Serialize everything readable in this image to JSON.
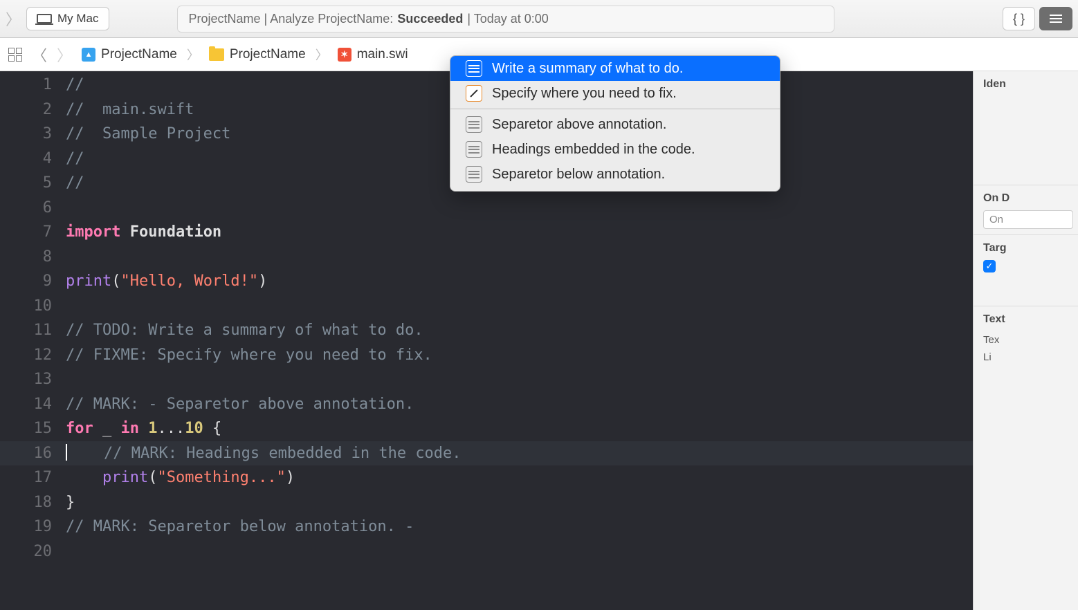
{
  "toolbar": {
    "device": "My Mac",
    "status_prefix": "ProjectName | Analyze ProjectName:",
    "status_result": "Succeeded",
    "status_time": "| Today at 0:00",
    "braces_btn": "{ }"
  },
  "jumpbar": {
    "proj": "ProjectName",
    "folder": "ProjectName",
    "file": "main.swi"
  },
  "dropdown": {
    "items": [
      {
        "label": "Write a summary of what to do.",
        "icon": "list-blue",
        "selected": true
      },
      {
        "label": "Specify where you need to fix.",
        "icon": "pencil-orange",
        "selected": false
      }
    ],
    "items2": [
      {
        "label": "Separetor above annotation."
      },
      {
        "label": "Headings embedded in the code."
      },
      {
        "label": "Separetor below annotation."
      }
    ]
  },
  "code": {
    "l1": "//",
    "l2_c": "//  main.swift",
    "l3_c": "//  Sample Project",
    "l4": "//",
    "l5": "//",
    "l7_kw": "import",
    "l7_ty": " Foundation",
    "l9_fn": "print",
    "l9_p1": "(",
    "l9_str": "\"Hello, World!\"",
    "l9_p2": ")",
    "l11": "// TODO: Write a summary of what to do.",
    "l12": "// FIXME: Specify where you need to fix.",
    "l14": "// MARK: - Separetor above annotation.",
    "l15_for": "for",
    "l15_mid": " _ ",
    "l15_in": "in",
    "l15_sp": " ",
    "l15_n1": "1",
    "l15_dots": "...",
    "l15_n2": "10",
    "l15_brace": " {",
    "l16": "    // MARK: Headings embedded in the code.",
    "l17_pad": "    ",
    "l17_fn": "print",
    "l17_p1": "(",
    "l17_str": "\"Something...\"",
    "l17_p2": ")",
    "l18": "}",
    "l19": "// MARK: Separetor below annotation. -"
  },
  "line_numbers": [
    "1",
    "2",
    "3",
    "4",
    "5",
    "6",
    "7",
    "8",
    "9",
    "10",
    "11",
    "12",
    "13",
    "14",
    "15",
    "16",
    "17",
    "18",
    "19",
    "20"
  ],
  "inspector": {
    "identity_label": "Iden",
    "ondemand_label": "On D",
    "ondemand_value": "On",
    "target_label": "Targ",
    "text_label": "Text",
    "text_row1": "Tex",
    "text_row2": "Li"
  }
}
